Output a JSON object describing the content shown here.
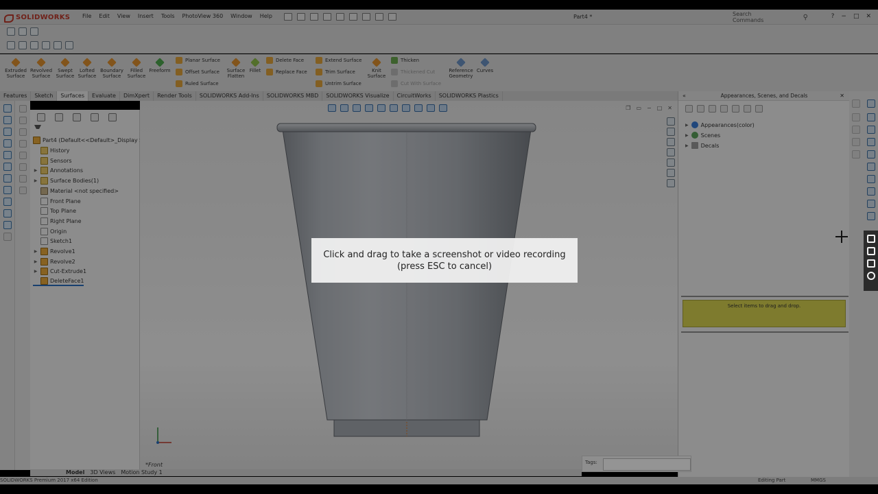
{
  "app": {
    "logo_text": "SOLIDWORKS",
    "document_title": "Part4 *",
    "search_placeholder": "Search Commands",
    "win_controls": [
      "?",
      "−",
      "□",
      "✕"
    ]
  },
  "menu": [
    "File",
    "Edit",
    "View",
    "Insert",
    "Tools",
    "PhotoView 360",
    "Window",
    "Help"
  ],
  "command_manager": {
    "big_tools": [
      {
        "label": "Extruded Surface"
      },
      {
        "label": "Revolved Surface"
      },
      {
        "label": "Swept Surface"
      },
      {
        "label": "Lofted Surface"
      },
      {
        "label": "Boundary Surface"
      },
      {
        "label": "Filled Surface"
      },
      {
        "label": "Freeform"
      }
    ],
    "col1": [
      "Planar Surface",
      "Offset Surface",
      "Ruled Surface"
    ],
    "mid_tools": [
      {
        "label": "Surface Flatten"
      },
      {
        "label": "Fillet"
      }
    ],
    "col2": [
      "Delete Face",
      "Replace Face"
    ],
    "col3": [
      "Extend Surface",
      "Trim Surface",
      "Untrim Surface"
    ],
    "knit": "Knit Surface",
    "col4": [
      "Thicken",
      "Thickened Cut",
      "Cut With Surface"
    ],
    "col4_disabled": [
      false,
      true,
      true
    ],
    "ref_geometry": "Reference Geometry",
    "curves": "Curves"
  },
  "tabs": [
    "Features",
    "Sketch",
    "Surfaces",
    "Evaluate",
    "DimXpert",
    "Render Tools",
    "SOLIDWORKS Add-Ins",
    "SOLIDWORKS MBD",
    "SOLIDWORKS Visualize",
    "CircuitWorks",
    "SOLIDWORKS Plastics"
  ],
  "active_tab": "Surfaces",
  "tree": {
    "root": "Part4  (Default<<Default>_Display State",
    "items": [
      {
        "label": "History",
        "icon": "folder",
        "arrow": ""
      },
      {
        "label": "Sensors",
        "icon": "folder",
        "arrow": ""
      },
      {
        "label": "Annotations",
        "icon": "folder",
        "arrow": "▶"
      },
      {
        "label": "Surface Bodies(1)",
        "icon": "folder",
        "arrow": "▶"
      },
      {
        "label": "Material <not specified>",
        "icon": "mat",
        "arrow": ""
      },
      {
        "label": "Front Plane",
        "icon": "plane",
        "arrow": ""
      },
      {
        "label": "Top Plane",
        "icon": "plane",
        "arrow": ""
      },
      {
        "label": "Right Plane",
        "icon": "plane",
        "arrow": ""
      },
      {
        "label": "Origin",
        "icon": "plane",
        "arrow": ""
      },
      {
        "label": "Sketch1",
        "icon": "plane",
        "arrow": ""
      },
      {
        "label": "Revolve1",
        "icon": "feat",
        "arrow": "▶"
      },
      {
        "label": "Revolve2",
        "icon": "feat",
        "arrow": "▶"
      },
      {
        "label": "Cut-Extrude1",
        "icon": "feat",
        "arrow": "▶"
      },
      {
        "label": "DeleteFace1",
        "icon": "feat",
        "arrow": ""
      }
    ]
  },
  "bottom_tabs": [
    "Model",
    "3D Views",
    "Motion Study 1"
  ],
  "viewport": {
    "view_label": "*Front"
  },
  "task_pane": {
    "title": "Appearances, Scenes, and Decals",
    "items": [
      {
        "label": "Appearances(color)",
        "color": "#3a7bd5"
      },
      {
        "label": "Scenes",
        "color": "#5aa05a"
      },
      {
        "label": "Decals",
        "color": "#9a9a9a"
      }
    ],
    "drop_hint": "Select items to drag and drop.",
    "tags_label": "Tags:"
  },
  "status": {
    "edition": "SOLIDWORKS Premium 2017 x64 Edition",
    "mode": "Editing Part",
    "units": "MMGS"
  },
  "overlay": {
    "line1": "Click and drag to take a screenshot or video recording",
    "line2": "(press ESC to cancel)"
  },
  "colors": {
    "brand": "#c0392b",
    "cup_body": "#b8bcc2",
    "drop_zone": "#d9d450"
  }
}
